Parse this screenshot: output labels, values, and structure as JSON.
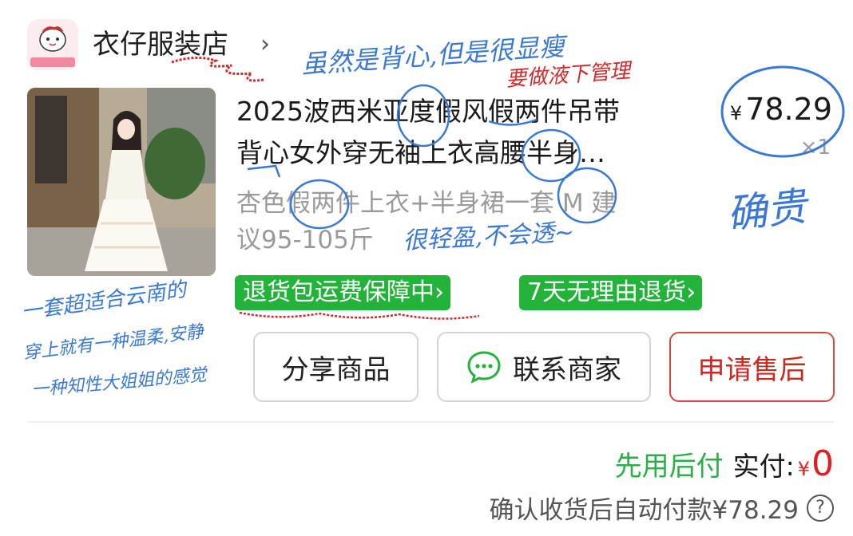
{
  "store": {
    "name": "衣仔服装店",
    "chevron": "›",
    "logo_icon": "store-logo-icon"
  },
  "product": {
    "title_line1": "2025波西米亚度假风假两件吊带",
    "title_line2": "背心女外穿无袖上衣高腰半身…",
    "spec_line1": "杏色假两件上衣+半身裙一套 M 建",
    "spec_line2": "议95-105斤",
    "price_currency": "¥",
    "price_value": "78.29",
    "quantity": "×1",
    "image_icon": "product-photo-white-dress"
  },
  "tags": {
    "shipping_insurance": "退货包运费保障中›",
    "seven_day_return": "7天无理由退货›"
  },
  "actions": {
    "share": "分享商品",
    "contact": "联系商家",
    "after_sale": "申请售后"
  },
  "payment": {
    "pay_later": "先用后付",
    "actual_label": "实付:",
    "actual_currency": "¥",
    "actual_value": "0",
    "auto_pay_text": "确认收货后自动付款¥78.29",
    "help_glyph": "?"
  },
  "annotations": {
    "note_top": "虽然是背心,但是很显瘦",
    "note_wash": "要做液下管理",
    "note_price": "确贵",
    "note_fabric": "很轻盈,不会透~",
    "note_left_1": "一套超适合云南的",
    "note_left_2": "穿上就有一种温柔,安静",
    "note_left_3": "一种知性大姐姐的感觉"
  },
  "colors": {
    "accent_green": "#23b33a",
    "price_red": "#e02020",
    "after_sale_red": "#d1261d",
    "annotation_blue": "#3a78d6",
    "annotation_red": "#d22a2a"
  }
}
